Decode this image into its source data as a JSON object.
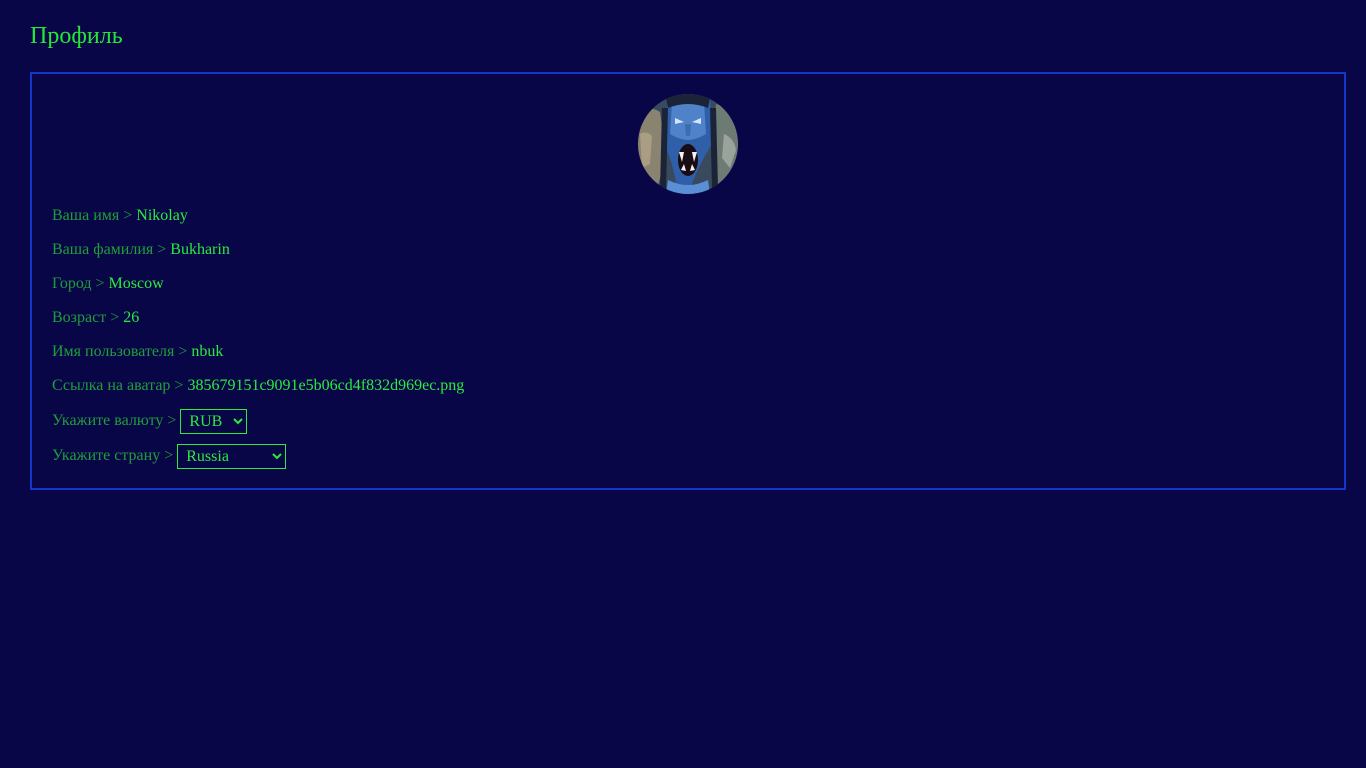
{
  "page": {
    "title": "Профиль"
  },
  "profile": {
    "first_name": {
      "label": "Ваша имя > ",
      "value": "Nikolay"
    },
    "last_name": {
      "label": "Ваша фамилия > ",
      "value": "Bukharin"
    },
    "city": {
      "label": "Город > ",
      "value": "Moscow"
    },
    "age": {
      "label": "Возраст > ",
      "value": "26"
    },
    "username": {
      "label": "Имя пользователя > ",
      "value": "nbuk"
    },
    "avatar_link": {
      "label": "Ссылка на аватар > ",
      "value": "385679151c9091e5b06cd4f832d969ec.png"
    },
    "currency": {
      "label": "Укажите валюту > ",
      "selected": "RUB"
    },
    "country": {
      "label": "Укажите страну > ",
      "selected": "Russia"
    }
  },
  "colors": {
    "background": "#080647",
    "border": "#1237c9",
    "text_label": "#1f9e3a",
    "text_value": "#2bea40",
    "title": "#27e63a"
  }
}
